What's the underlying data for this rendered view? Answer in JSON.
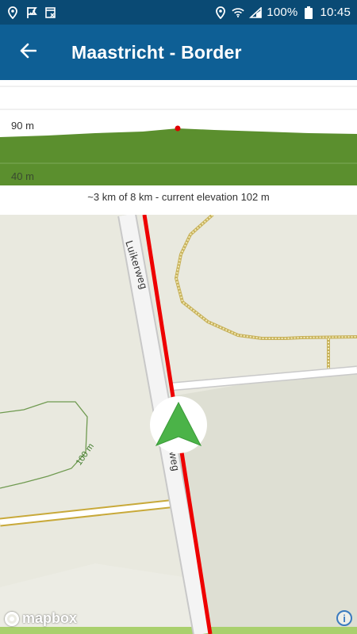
{
  "status_bar": {
    "battery": "100%",
    "time": "10:45"
  },
  "app_bar": {
    "title": "Maastricht - Border",
    "back_icon": "arrow-left-icon"
  },
  "elevation": {
    "label_top": "90 m",
    "label_bottom": "40 m",
    "caption": "~3 km of 8 km - current elevation 102 m",
    "progress_km": 3,
    "total_km": 8,
    "current_elevation_m": 102
  },
  "map": {
    "street_label_1": "Luikerweg",
    "street_label_2": "erweg",
    "contour_label": "100 m",
    "attribution": "mapbox"
  },
  "colors": {
    "status_bar": "#0a4a74",
    "app_bar": "#0e5f95",
    "terrain": "#5b8f2e",
    "route": "#ee0000",
    "position_arrow": "#4bb348"
  }
}
